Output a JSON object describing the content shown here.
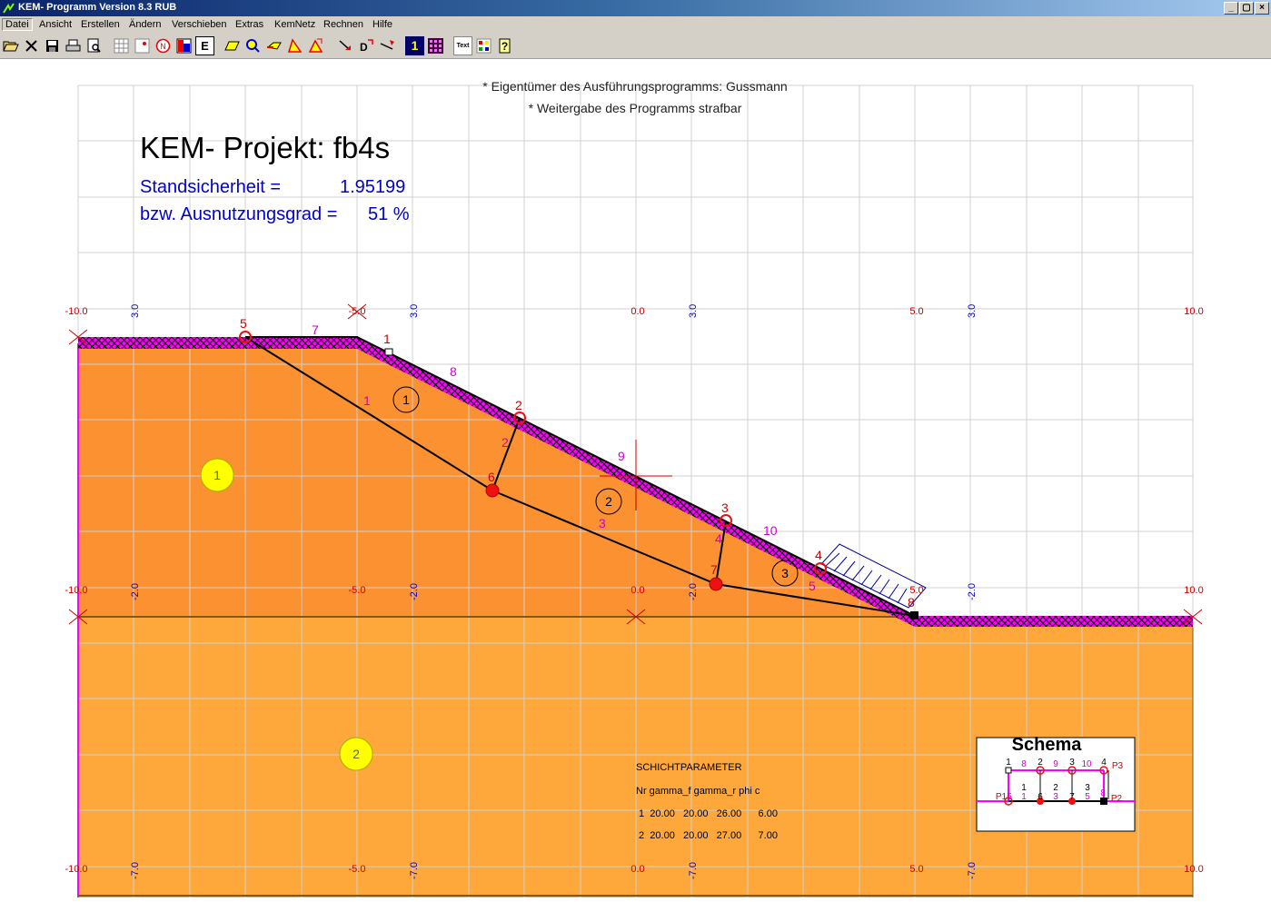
{
  "window": {
    "title": "KEM- Programm Version 8.3 RUB",
    "buttons": [
      "_",
      "▢",
      "×"
    ]
  },
  "menu": [
    "Datei",
    "Ansicht",
    "Erstellen",
    "Ändern",
    "Verschieben",
    "Extras",
    "KemNetz",
    "Rechnen",
    "Hilfe"
  ],
  "toolbar": {
    "e_label": "E",
    "one_label": "1",
    "text_label": "Text"
  },
  "notice": {
    "line1": "* Eigentümer des Ausführungsprogramms: Gussmann",
    "line2": "* Weitergabe des Programms strafbar"
  },
  "project": {
    "title": "KEM- Projekt: fb4s",
    "safety_label": "Standsicherheit =",
    "safety_value": "1.95199",
    "util_label": "bzw. Ausnutzungsgrad =",
    "util_value": "51 %"
  },
  "axis": {
    "x_row_top": [
      "-10.0",
      "-5.0",
      "0.0",
      "5.0",
      "10.0"
    ],
    "x_row_mid": [
      "-10.0",
      "-5.0",
      "0.0",
      "5.0",
      "10.0"
    ],
    "x_row_bot": [
      "-10.0",
      "-5.0",
      "0.0",
      "5.0",
      "10.0"
    ],
    "y_top": "3.0",
    "y_mid": "-2.0",
    "y_bot": "-7.0"
  },
  "labels": {
    "nodes": [
      "1",
      "2",
      "3",
      "4",
      "5",
      "6",
      "7",
      "8"
    ],
    "edges": [
      "1",
      "2",
      "3",
      "4",
      "5",
      "7",
      "8",
      "9",
      "10"
    ],
    "blocks": [
      "1",
      "2",
      "3"
    ],
    "layers": [
      "1",
      "2"
    ]
  },
  "layer_params": {
    "heading": "SCHICHTPARAMETER",
    "columns": "Nr gamma_f gamma_r phi c",
    "rows": [
      " 1  20.00   20.00   26.00      6.00",
      " 2  20.00   20.00   27.00      7.00"
    ]
  },
  "schema": {
    "title": "Schema",
    "top_labels": [
      "1",
      "8",
      "2",
      "9",
      "3",
      "10",
      "4",
      "P3"
    ],
    "mid_labels": [
      "1",
      "2",
      "3"
    ],
    "bot_labels": [
      "P1",
      "5",
      "1",
      "6",
      "3",
      "7",
      "5",
      "8",
      "P2"
    ]
  },
  "colors": {
    "soil_upper": "#fb9130",
    "soil_lower": "#fea83c",
    "surface": "#ff00ff",
    "node_red": "#ee1111",
    "axis_red": "#cc0000",
    "axis_blue": "#0000cc",
    "text_blue": "#0000cc",
    "magenta_text": "#cc00cc",
    "layer_yellow": "#ffff00"
  }
}
